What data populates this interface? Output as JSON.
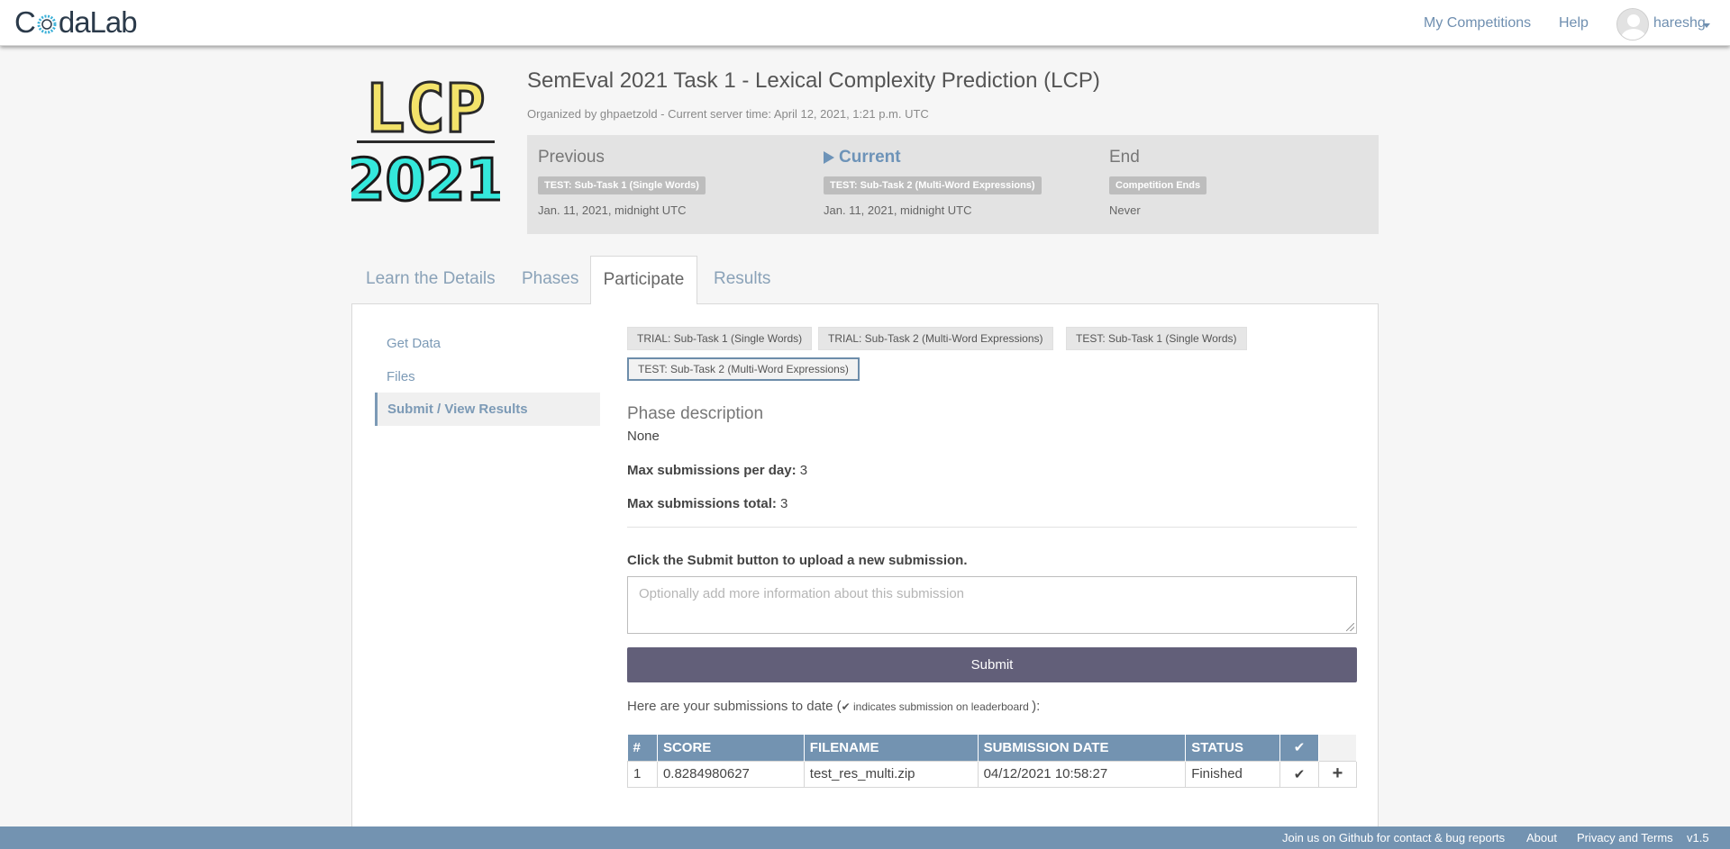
{
  "nav": {
    "brand_left": "C",
    "brand_right": "daLab",
    "my_competitions": "My Competitions",
    "help": "Help",
    "username": "hareshg"
  },
  "competition": {
    "logo_line1": "LCP",
    "logo_line2": "2021",
    "title": "SemEval 2021 Task 1 - Lexical Complexity Prediction (LCP)",
    "meta": "Organized by ghpaetzold - Current server time: April 12, 2021, 1:21 p.m. UTC"
  },
  "phases": {
    "previous": {
      "heading": "Previous",
      "badge": "TEST: Sub-Task 1 (Single Words)",
      "date": "Jan. 11, 2021, midnight UTC"
    },
    "current": {
      "heading": "Current",
      "badge": "TEST: Sub-Task 2 (Multi-Word Expressions)",
      "date": "Jan. 11, 2021, midnight UTC"
    },
    "end": {
      "heading": "End",
      "badge": "Competition Ends",
      "date": "Never"
    }
  },
  "tabs": [
    "Learn the Details",
    "Phases",
    "Participate",
    "Results"
  ],
  "sidebar": [
    "Get Data",
    "Files",
    "Submit / View Results"
  ],
  "phase_buttons": [
    "TRIAL: Sub-Task 1 (Single Words)",
    "TRIAL: Sub-Task 2 (Multi-Word Expressions)",
    "TEST: Sub-Task 1 (Single Words)",
    "TEST: Sub-Task 2 (Multi-Word Expressions)"
  ],
  "participate": {
    "phase_desc_title": "Phase description",
    "phase_desc": "None",
    "max_per_day_label": "Max submissions per day:",
    "max_per_day": "3",
    "max_total_label": "Max submissions total:",
    "max_total": "3",
    "upload_prompt": "Click the Submit button to upload a new submission.",
    "notes_placeholder": "Optionally add more information about this submission",
    "submit_label": "Submit",
    "subs_note_pre": "Here are your submissions to date (",
    "subs_note_mid": " indicates submission on leaderboard ",
    "subs_note_post": "):"
  },
  "table": {
    "headers": [
      "#",
      "SCORE",
      "FILENAME",
      "SUBMISSION DATE",
      "STATUS"
    ],
    "rows": [
      {
        "num": "1",
        "score": "0.8284980627",
        "filename": "test_res_multi.zip",
        "date": "04/12/2021 10:58:27",
        "status": "Finished"
      }
    ]
  },
  "footer": {
    "github": "Join us on Github for contact & bug reports",
    "about": "About",
    "privacy": "Privacy and Terms",
    "version": "v1.5"
  },
  "colors": {
    "accent": "#7393b1",
    "submit": "#625f79",
    "logo_yellow": "#f3e36a",
    "logo_cyan": "#34e8dc"
  }
}
